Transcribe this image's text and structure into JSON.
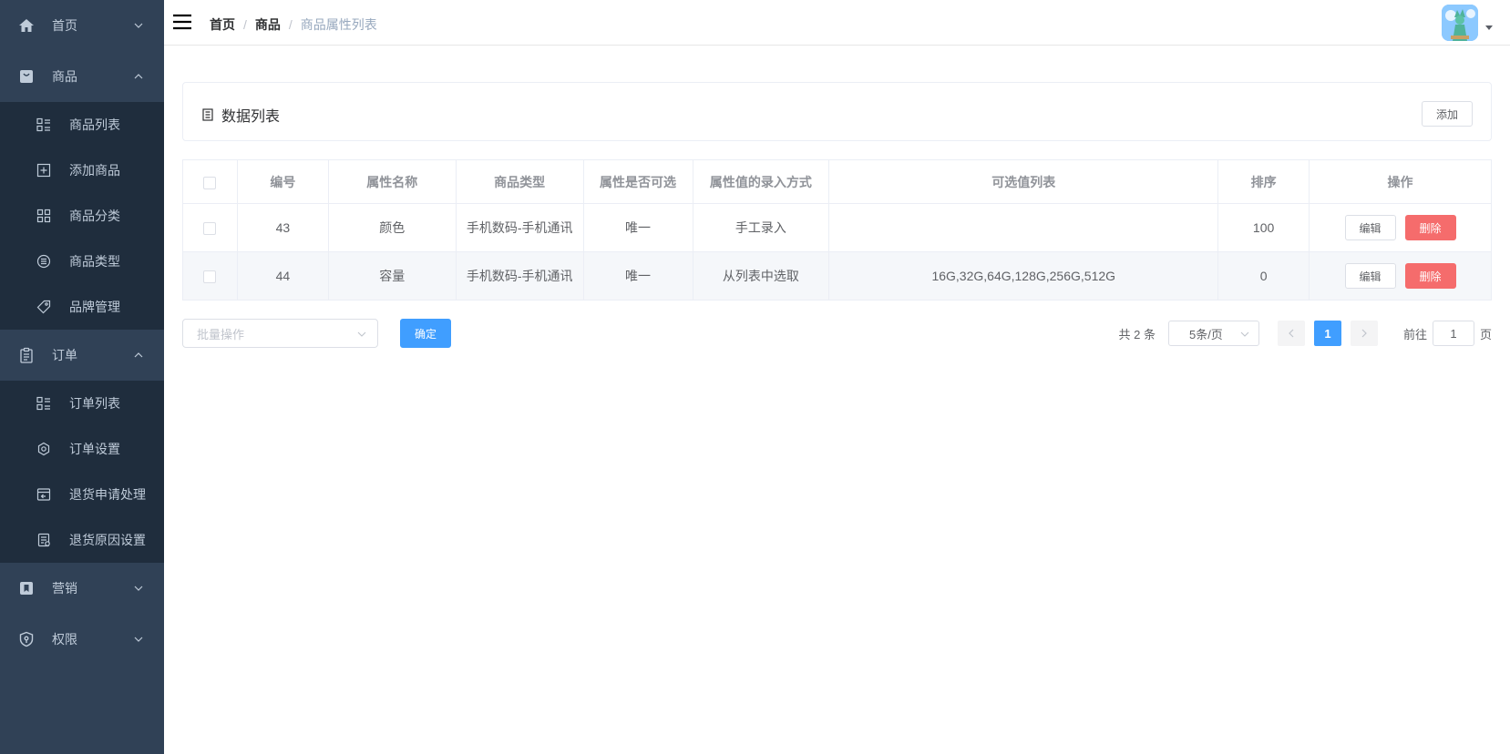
{
  "sidebar": {
    "items": [
      {
        "label": "首页",
        "icon": "home-icon"
      },
      {
        "label": "商品",
        "icon": "bag-icon"
      },
      {
        "label": "订单",
        "icon": "clipboard-icon"
      },
      {
        "label": "营销",
        "icon": "bookmark-icon"
      },
      {
        "label": "权限",
        "icon": "shield-icon"
      }
    ],
    "product_sub": [
      {
        "label": "商品列表",
        "icon": "list-icon"
      },
      {
        "label": "添加商品",
        "icon": "add-square-icon"
      },
      {
        "label": "商品分类",
        "icon": "grid-icon"
      },
      {
        "label": "商品类型",
        "icon": "list-circle-icon"
      },
      {
        "label": "品牌管理",
        "icon": "tag-icon"
      }
    ],
    "order_sub": [
      {
        "label": "订单列表",
        "icon": "list-icon"
      },
      {
        "label": "订单设置",
        "icon": "gear-icon"
      },
      {
        "label": "退货申请处理",
        "icon": "return-icon"
      },
      {
        "label": "退货原因设置",
        "icon": "document-icon"
      }
    ]
  },
  "navbar": {
    "breadcrumb": [
      "首页",
      "商品",
      "商品属性列表"
    ],
    "separator": "/"
  },
  "card": {
    "title": "数据列表",
    "add_label": "添加"
  },
  "table": {
    "headers": [
      "编号",
      "属性名称",
      "商品类型",
      "属性是否可选",
      "属性值的录入方式",
      "可选值列表",
      "排序",
      "操作"
    ],
    "rows": [
      {
        "id": "43",
        "name": "颜色",
        "type": "手机数码-手机通讯",
        "selectable": "唯一",
        "input_type": "手工录入",
        "values": "",
        "sort": "100",
        "edit": "编辑",
        "delete": "删除"
      },
      {
        "id": "44",
        "name": "容量",
        "type": "手机数码-手机通讯",
        "selectable": "唯一",
        "input_type": "从列表中选取",
        "values": "16G,32G,64G,128G,256G,512G",
        "sort": "0",
        "edit": "编辑",
        "delete": "删除"
      }
    ]
  },
  "bottom": {
    "batch_placeholder": "批量操作",
    "confirm_label": "确定"
  },
  "pagination": {
    "total_text": "共 2 条",
    "page_size": "5条/页",
    "current_page": "1",
    "goto_label": "前往",
    "goto_value": "1",
    "page_suffix": "页"
  },
  "colors": {
    "sidebar_bg": "#304156",
    "submenu_bg": "#1f2d3d",
    "primary": "#409eff",
    "danger": "#f56c6c"
  }
}
